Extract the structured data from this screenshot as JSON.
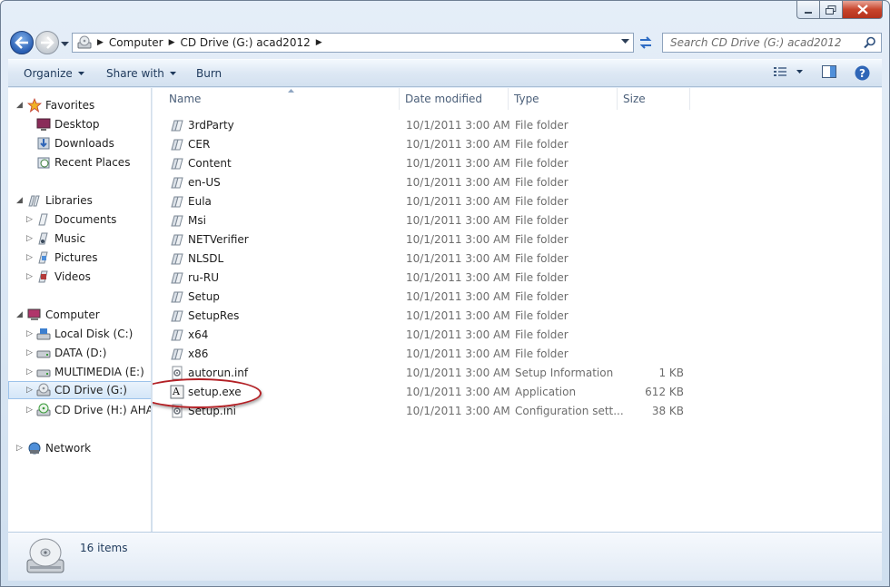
{
  "window": {
    "caption_buttons": [
      "minimize",
      "maximize",
      "close"
    ]
  },
  "address": {
    "crumbs": [
      "Computer",
      "CD Drive (G:) acad2012"
    ]
  },
  "search": {
    "placeholder": "Search CD Drive (G:) acad2012"
  },
  "toolbar": {
    "organize": "Organize",
    "share_with": "Share with",
    "burn": "Burn"
  },
  "navpane": {
    "favorites": {
      "label": "Favorites",
      "items": [
        "Desktop",
        "Downloads",
        "Recent Places"
      ]
    },
    "libraries": {
      "label": "Libraries",
      "items": [
        "Documents",
        "Music",
        "Pictures",
        "Videos"
      ]
    },
    "computer": {
      "label": "Computer",
      "items": [
        "Local Disk (C:)",
        "DATA (D:)",
        "MULTIMEDIA (E:)",
        "CD Drive (G:)",
        "CD Drive (H:) AHA D"
      ]
    },
    "network": {
      "label": "Network"
    },
    "selected": "CD Drive (G:)"
  },
  "columns": {
    "name": "Name",
    "date": "Date modified",
    "type": "Type",
    "size": "Size"
  },
  "files": [
    {
      "name": "3rdParty",
      "date": "10/1/2011 3:00 AM",
      "type": "File folder",
      "size": "",
      "icon": "folder-icon"
    },
    {
      "name": "CER",
      "date": "10/1/2011 3:00 AM",
      "type": "File folder",
      "size": "",
      "icon": "folder-icon"
    },
    {
      "name": "Content",
      "date": "10/1/2011 3:00 AM",
      "type": "File folder",
      "size": "",
      "icon": "folder-icon"
    },
    {
      "name": "en-US",
      "date": "10/1/2011 3:00 AM",
      "type": "File folder",
      "size": "",
      "icon": "folder-icon"
    },
    {
      "name": "Eula",
      "date": "10/1/2011 3:00 AM",
      "type": "File folder",
      "size": "",
      "icon": "folder-icon"
    },
    {
      "name": "Msi",
      "date": "10/1/2011 3:00 AM",
      "type": "File folder",
      "size": "",
      "icon": "folder-icon"
    },
    {
      "name": "NETVerifier",
      "date": "10/1/2011 3:00 AM",
      "type": "File folder",
      "size": "",
      "icon": "folder-icon"
    },
    {
      "name": "NLSDL",
      "date": "10/1/2011 3:00 AM",
      "type": "File folder",
      "size": "",
      "icon": "folder-icon"
    },
    {
      "name": "ru-RU",
      "date": "10/1/2011 3:00 AM",
      "type": "File folder",
      "size": "",
      "icon": "folder-icon"
    },
    {
      "name": "Setup",
      "date": "10/1/2011 3:00 AM",
      "type": "File folder",
      "size": "",
      "icon": "folder-icon"
    },
    {
      "name": "SetupRes",
      "date": "10/1/2011 3:00 AM",
      "type": "File folder",
      "size": "",
      "icon": "folder-icon"
    },
    {
      "name": "x64",
      "date": "10/1/2011 3:00 AM",
      "type": "File folder",
      "size": "",
      "icon": "folder-icon"
    },
    {
      "name": "x86",
      "date": "10/1/2011 3:00 AM",
      "type": "File folder",
      "size": "",
      "icon": "folder-icon"
    },
    {
      "name": "autorun.inf",
      "date": "10/1/2011 3:00 AM",
      "type": "Setup Information",
      "size": "1 KB",
      "icon": "settings-file-icon"
    },
    {
      "name": "setup.exe",
      "date": "10/1/2011 3:00 AM",
      "type": "Application",
      "size": "612 KB",
      "icon": "autocad-app-icon"
    },
    {
      "name": "Setup.ini",
      "date": "10/1/2011 3:00 AM",
      "type": "Configuration sett...",
      "size": "38 KB",
      "icon": "settings-file-icon"
    }
  ],
  "status": {
    "count": "16 items"
  },
  "colors": {
    "highlight_ellipse": "#b32025",
    "selection": "#d4e6f8"
  }
}
